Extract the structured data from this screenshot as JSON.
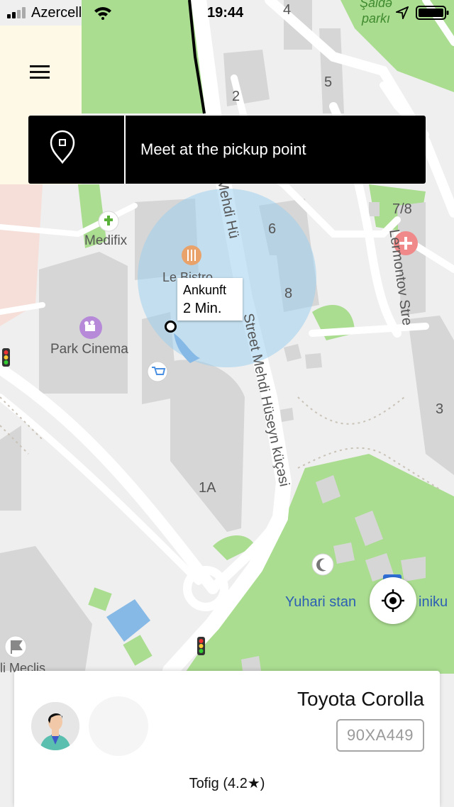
{
  "status_bar": {
    "carrier": "Azercell",
    "time": "19:44"
  },
  "banner": {
    "icon": "pin-icon",
    "text": "Meet at the pickup point"
  },
  "eta": {
    "label": "Ankunft",
    "value": "2 Min."
  },
  "map": {
    "labels": {
      "saida": "Şaidə",
      "parki": "parkı",
      "num4": "4",
      "num2": "2",
      "num5": "5",
      "num7_8": "7/8",
      "num6": "6",
      "num8": "8",
      "num3": "3",
      "num1a": "1A",
      "medifix": "Medifix",
      "le_bistro": "Le Bistro",
      "park_cinema": "Park Cinema",
      "lermontov": "Lermontov Stre",
      "street_upper": "Mehdi Hü",
      "street_mid": "Street Mehdi Hüseyn küçəsi",
      "yuhari": "Yuhari stan",
      "funiku": "iniku",
      "meclis": "li Meclis"
    },
    "colors": {
      "park": "#aadd90",
      "road": "#ffffff",
      "building": "#d6d6d6",
      "water": "#86b9e6",
      "radius": "#9fcfef"
    }
  },
  "ride": {
    "car_model": "Toyota Corolla",
    "plate": "90XA449",
    "driver": "Tofig (4.2★)"
  }
}
